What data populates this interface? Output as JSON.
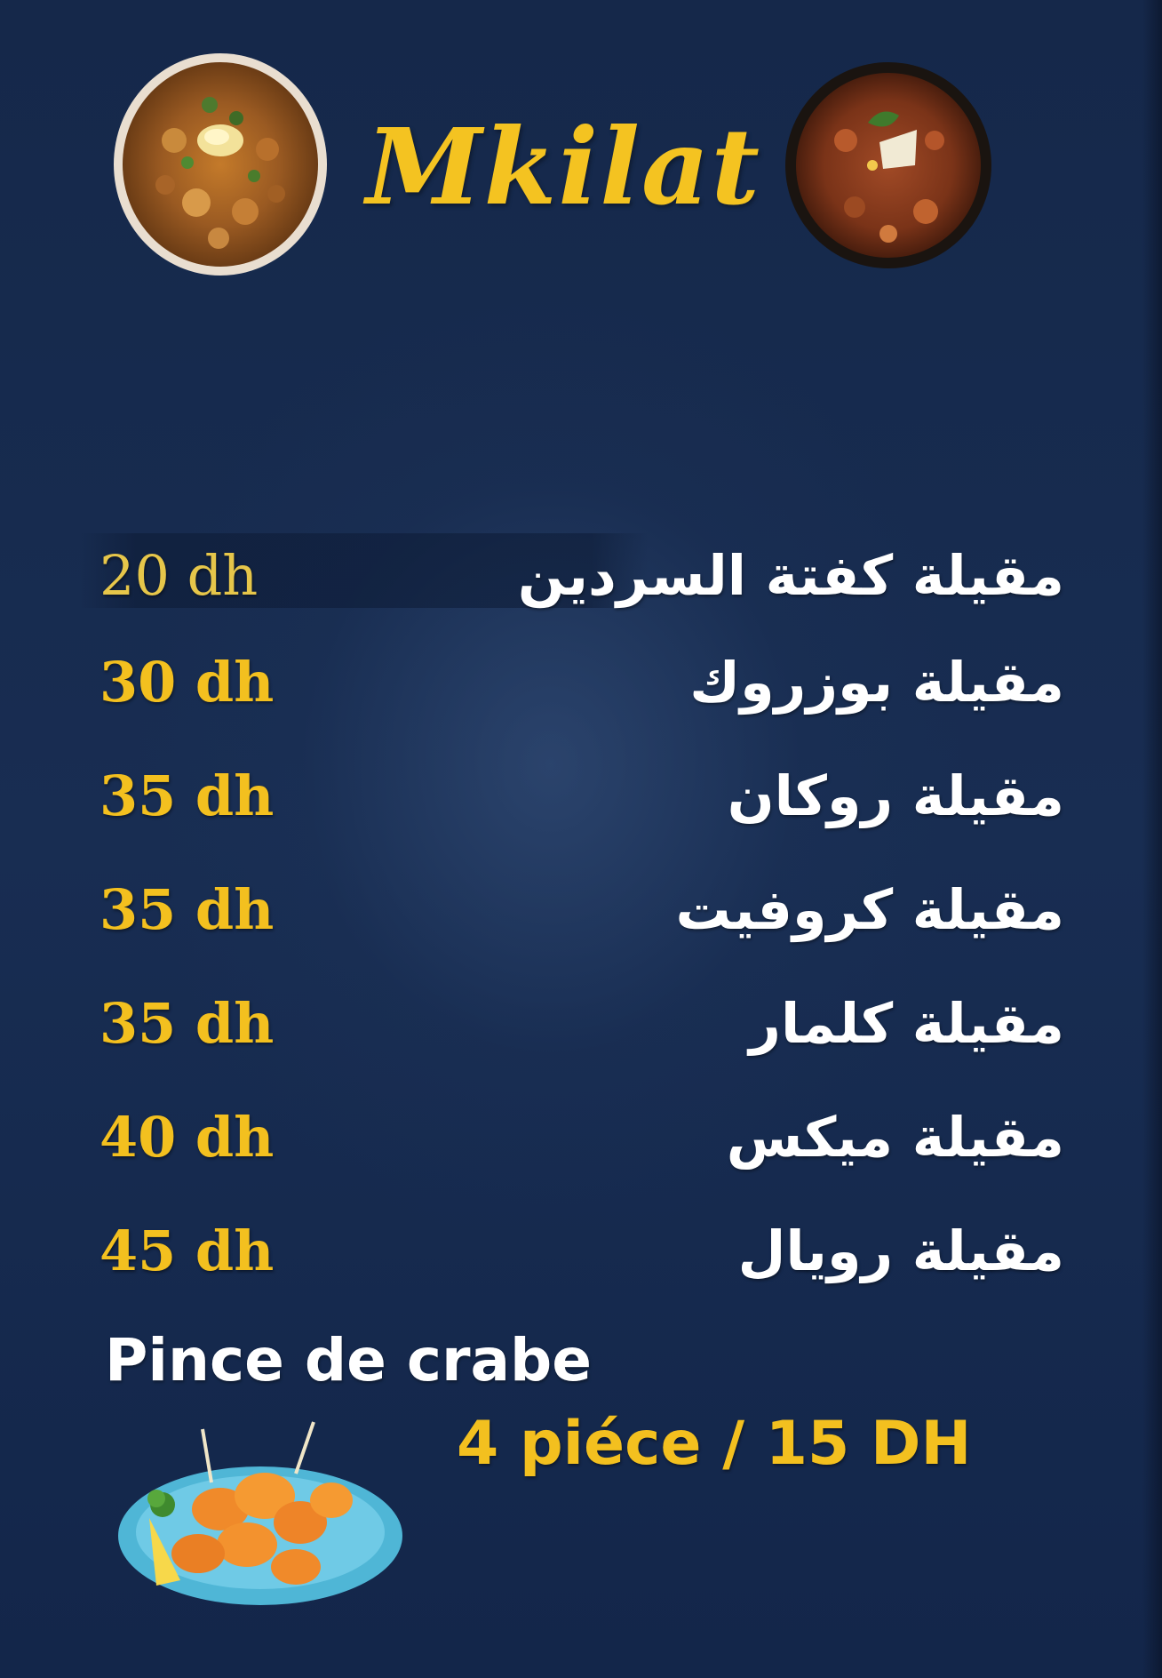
{
  "header": {
    "title": "Mkilat",
    "left_image_icon": "food-bowl-icon",
    "right_image_icon": "food-bowl-icon"
  },
  "menu": {
    "items": [
      {
        "name": "مقيلة كفتة السردين",
        "price": "20 dh"
      },
      {
        "name": "مقيلة بوزروك",
        "price": "30 dh"
      },
      {
        "name": "مقيلة روكان",
        "price": "35 dh"
      },
      {
        "name": "مقيلة كروفيت",
        "price": "35 dh"
      },
      {
        "name": "مقيلة كلمار",
        "price": "35 dh"
      },
      {
        "name": "مقيلة ميكس",
        "price": "40 dh"
      },
      {
        "name": "مقيلة رويال",
        "price": "45 dh"
      }
    ]
  },
  "extra": {
    "title": "Pince de crabe",
    "price": "4 piéce / 15 DH",
    "image_icon": "crab-plate-icon"
  },
  "colors": {
    "background": "#16294a",
    "accent": "#f3c01f",
    "text": "#ffffff"
  }
}
